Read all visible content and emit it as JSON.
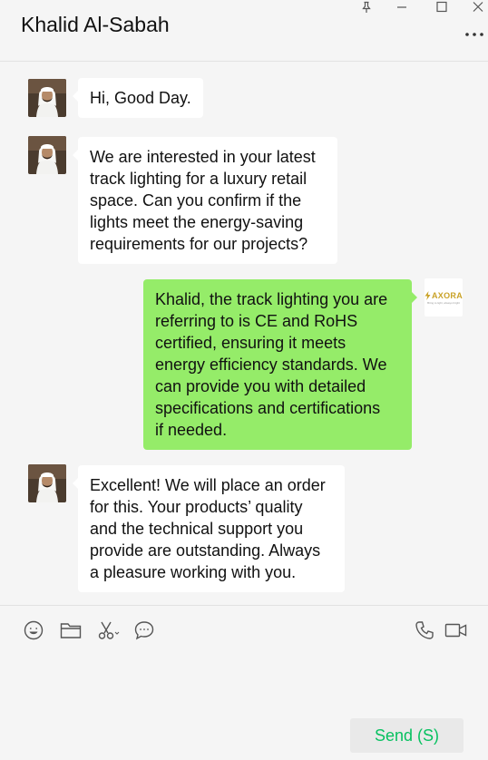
{
  "header": {
    "title": "Khalid Al-Sabah",
    "window_controls": [
      "pin-icon",
      "minimize-icon",
      "maximize-icon",
      "close-icon"
    ],
    "more_icon": "more-icon"
  },
  "messages": [
    {
      "sender": "Khalid Al-Sabah",
      "direction": "incoming",
      "text": "Hi, Good Day."
    },
    {
      "sender": "Khalid Al-Sabah",
      "direction": "incoming",
      "text": "We are interested in your latest\ntrack lighting for a luxury retail\nspace. Can you confirm if the\nlights meet the energy-saving\nrequirements for our projects?"
    },
    {
      "sender": "AXORA",
      "direction": "outgoing",
      "text": "Khalid, the track lighting you are\nreferring to is CE and RoHS\ncertified, ensuring it meets\nenergy efficiency standards. We\ncan provide you with detailed\nspecifications and certifications\nif needed."
    },
    {
      "sender": "Khalid Al-Sabah",
      "direction": "incoming",
      "text": "Excellent! We will place an order\nfor this. Your products’   quality\nand the technical support you\nprovide are outstanding. Always\na pleasure working with you."
    }
  ],
  "self_avatar": {
    "brand": "AXORA",
    "tagline": "Bring to light, always bright"
  },
  "toolbar": {
    "left_icons": [
      "emoji-icon",
      "folder-icon",
      "scissors-icon",
      "chat-bubble-icon"
    ],
    "right_icons": [
      "phone-icon",
      "video-call-icon"
    ]
  },
  "composer": {
    "text": ""
  },
  "send_button": {
    "label": "Send (S)"
  },
  "colors": {
    "background": "#f5f5f5",
    "incoming_bubble": "#ffffff",
    "outgoing_bubble": "#95ec69",
    "send_text": "#07c160",
    "brand_gold": "#c9a227"
  }
}
